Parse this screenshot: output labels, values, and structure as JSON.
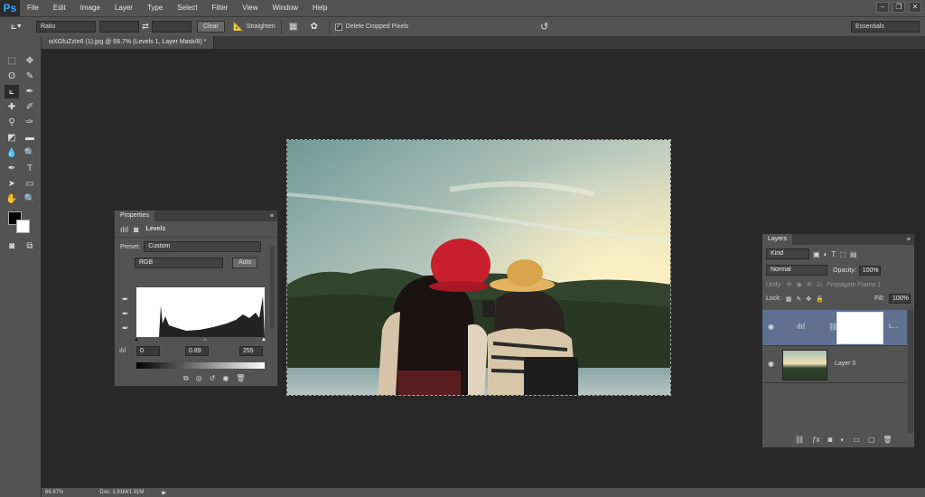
{
  "app": {
    "logo": "Ps"
  },
  "menu": [
    "File",
    "Edit",
    "Image",
    "Layer",
    "Type",
    "Select",
    "Filter",
    "View",
    "Window",
    "Help"
  ],
  "options": {
    "ratio": "Ratio",
    "clear": "Clear",
    "straighten": "Straighten",
    "delete_cropped": "Delete Cropped Pixels",
    "workspace": "Essentials"
  },
  "document": {
    "tab_title": "wXGfuZzIe6 (1).jpg @ 66.7% (Levels 1, Layer Mask/8) *"
  },
  "properties": {
    "tab": "Properties",
    "title": "Levels",
    "preset_label": "Preset:",
    "preset_value": "Custom",
    "channel": "RGB",
    "auto_label": "Auto",
    "black_input": "0",
    "gamma_input": "0.89",
    "white_input": "255"
  },
  "layers": {
    "tab": "Layers",
    "kind": "Kind",
    "blend_mode": "Normal",
    "opacity_label": "Opacity:",
    "opacity_value": "100%",
    "unify_label": "Unify:",
    "propagate_label": "Propagate Frame 1",
    "lock_label": "Lock:",
    "fill_label": "Fill:",
    "fill_value": "100%",
    "items": [
      {
        "name": "L...",
        "type": "adjustment"
      },
      {
        "name": "Layer 0",
        "type": "pixel"
      }
    ]
  },
  "status": {
    "zoom": "66.67%",
    "doc": "Doc: 1.91M/1.91M"
  },
  "colors": {
    "accent": "#31a8ff",
    "panel": "#535353",
    "selected_layer": "#5f7090"
  }
}
